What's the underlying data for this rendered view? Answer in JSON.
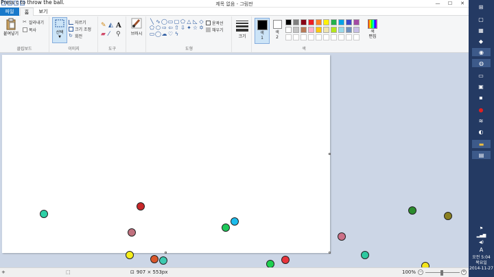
{
  "overlay_text": "Press c to throw the ball.",
  "title": "제목 없음 - 그림판",
  "window_controls": {
    "minimize": "—",
    "maximize": "☐",
    "close": "✕"
  },
  "tabs": {
    "file": "파일",
    "home": "홈",
    "view": "보기"
  },
  "ribbon": {
    "clipboard": {
      "label": "클립보드",
      "paste": "붙여넣기",
      "cut": "잘라내기",
      "copy": "복사"
    },
    "image": {
      "label": "이미지",
      "select": "선택",
      "crop": "자르기",
      "resize": "크기 조정",
      "rotate": "회전"
    },
    "tools": {
      "label": "도구"
    },
    "brushes": {
      "label": "브러시"
    },
    "shapes": {
      "label": "도형",
      "outline": "윤곽선",
      "fill": "채우기"
    },
    "size": {
      "label": "크기"
    },
    "colors": {
      "label": "색",
      "color1": "색\n1",
      "color2": "색\n2",
      "edit": "색\n편집",
      "palette": [
        "#000000",
        "#7f7f7f",
        "#880015",
        "#ed1c24",
        "#ff7f27",
        "#fff200",
        "#22b14c",
        "#00a2e8",
        "#3f48cc",
        "#a349a4",
        "#ffffff",
        "#c3c3c3",
        "#b97a57",
        "#ffaec9",
        "#ffc90e",
        "#efe4b0",
        "#b5e61d",
        "#99d9ea",
        "#7092be",
        "#c8bfe7"
      ]
    }
  },
  "status": {
    "dimensions": "907 × 553px",
    "zoom": "100%"
  },
  "clock": {
    "time": "오전 5:04",
    "day": "목요일",
    "date": "2014-11-27"
  },
  "balls": [
    {
      "name": "ball-teal-1",
      "color": "#2ed0a6"
    },
    {
      "name": "ball-red-1",
      "color": "#c8282a"
    },
    {
      "name": "ball-pink-1",
      "color": "#c0707e"
    },
    {
      "name": "ball-green-1",
      "color": "#1ec85a"
    },
    {
      "name": "ball-cyan-1",
      "color": "#1cbcec"
    },
    {
      "name": "ball-yellow-1",
      "color": "#f5ee1c"
    },
    {
      "name": "ball-orange-1",
      "color": "#d9562a"
    },
    {
      "name": "ball-teal-2",
      "color": "#3ccab0"
    },
    {
      "name": "ball-green-2",
      "color": "#1ed050"
    },
    {
      "name": "ball-red-2",
      "color": "#e8343c"
    },
    {
      "name": "ball-olive-1",
      "color": "#8c8324"
    },
    {
      "name": "ball-pink-2",
      "color": "#cc7088"
    },
    {
      "name": "ball-teal-3",
      "color": "#2ec8a0"
    },
    {
      "name": "ball-darkgreen-1",
      "color": "#2c8c2e"
    },
    {
      "name": "ball-olive-2",
      "color": "#8a8020"
    },
    {
      "name": "ball-yellow-2",
      "color": "#f2e41a"
    }
  ]
}
